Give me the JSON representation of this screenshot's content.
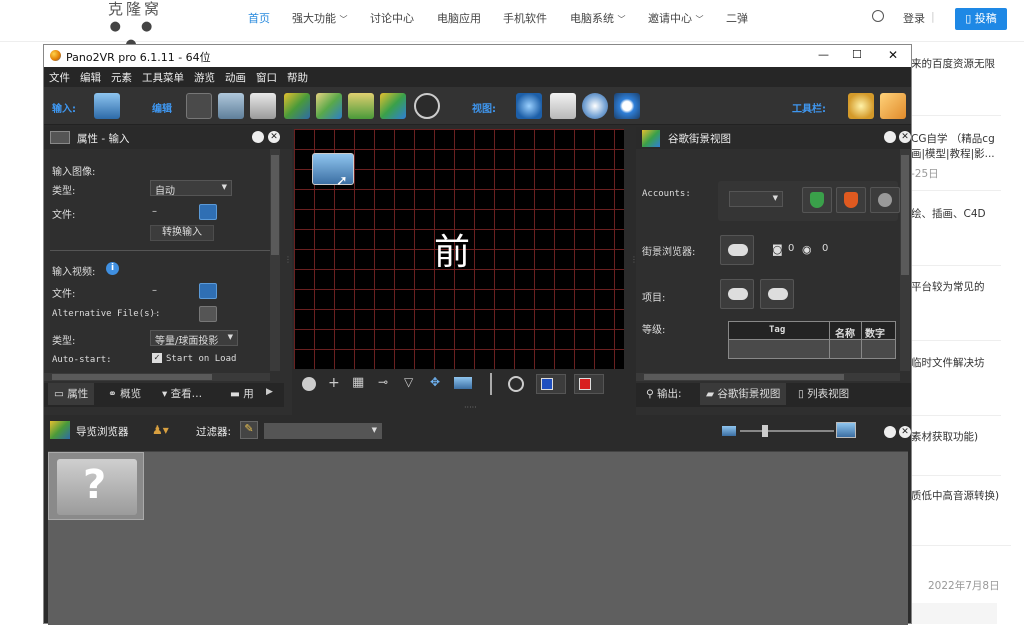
{
  "site": {
    "logo_text": "克隆窝",
    "logo_dots": "● ● ●",
    "nav": [
      "首页",
      "强大功能",
      "讨论中心",
      "电脑应用",
      "手机软件",
      "电脑系统",
      "邀请中心",
      "二弹"
    ],
    "nav_dropdowns": [
      "",
      "﹀",
      "",
      "",
      "",
      "﹀",
      "﹀",
      ""
    ],
    "login": "登录",
    "post_button": "投稿",
    "sidebar": [
      "来的百度资源无限",
      "CG自学 （精品cg",
      "画|模型|教程|影...",
      "-25日",
      "绘、插画、C4D",
      "平台较为常见的",
      "临时文件解决坊",
      "素材获取功能)",
      "质低中高音源转换)",
      "2022年7月8日"
    ]
  },
  "app": {
    "title": "Pano2VR pro 6.1.11 - 64位",
    "window_controls": [
      "—",
      "☐",
      "✕"
    ],
    "menu": [
      "文件",
      "编辑",
      "元素",
      "工具菜单",
      "游览",
      "动画",
      "窗口",
      "帮助"
    ],
    "toolbar": {
      "input_label": "输入:",
      "edit_label": "编辑",
      "view_label": "视图:",
      "tools_label": "工具栏:"
    },
    "properties": {
      "title": "属性 - 输入",
      "input_image": "输入图像:",
      "type_label": "类型:",
      "type_value": "自动",
      "file_label": "文件:",
      "file_value": "–",
      "convert_button": "转换输入",
      "input_video": "输入视频:",
      "video_file_label": "文件:",
      "video_file_value": "–",
      "alt_files_label": "Alternative File(s):",
      "alt_files_value": "–",
      "video_type_label": "类型:",
      "video_type_value": "等量/球面投影",
      "autostart_label": "Auto-start:",
      "autostart_value": "Start on Load",
      "tabs": [
        "属性",
        "概览",
        "查看…",
        "用"
      ]
    },
    "viewer": {
      "face_label": "前"
    },
    "gsv": {
      "title": "谷歌街景视图",
      "accounts_label": "Accounts:",
      "browser_label": "街景浏览器:",
      "photo_count": "0",
      "view_count": "0",
      "project_label": "项目:",
      "level_label": "等级:",
      "table_headers": [
        "Tag",
        "名称",
        "数字"
      ],
      "tabs": [
        "输出:",
        "谷歌街景视图",
        "列表视图"
      ]
    },
    "tour_browser": {
      "title": "导览浏览器",
      "filter_label": "过滤器:"
    }
  },
  "colors": {
    "accent_blue": "#1e88e5",
    "app_bg": "#2b2b2b",
    "grid_line": "#6a2020"
  }
}
